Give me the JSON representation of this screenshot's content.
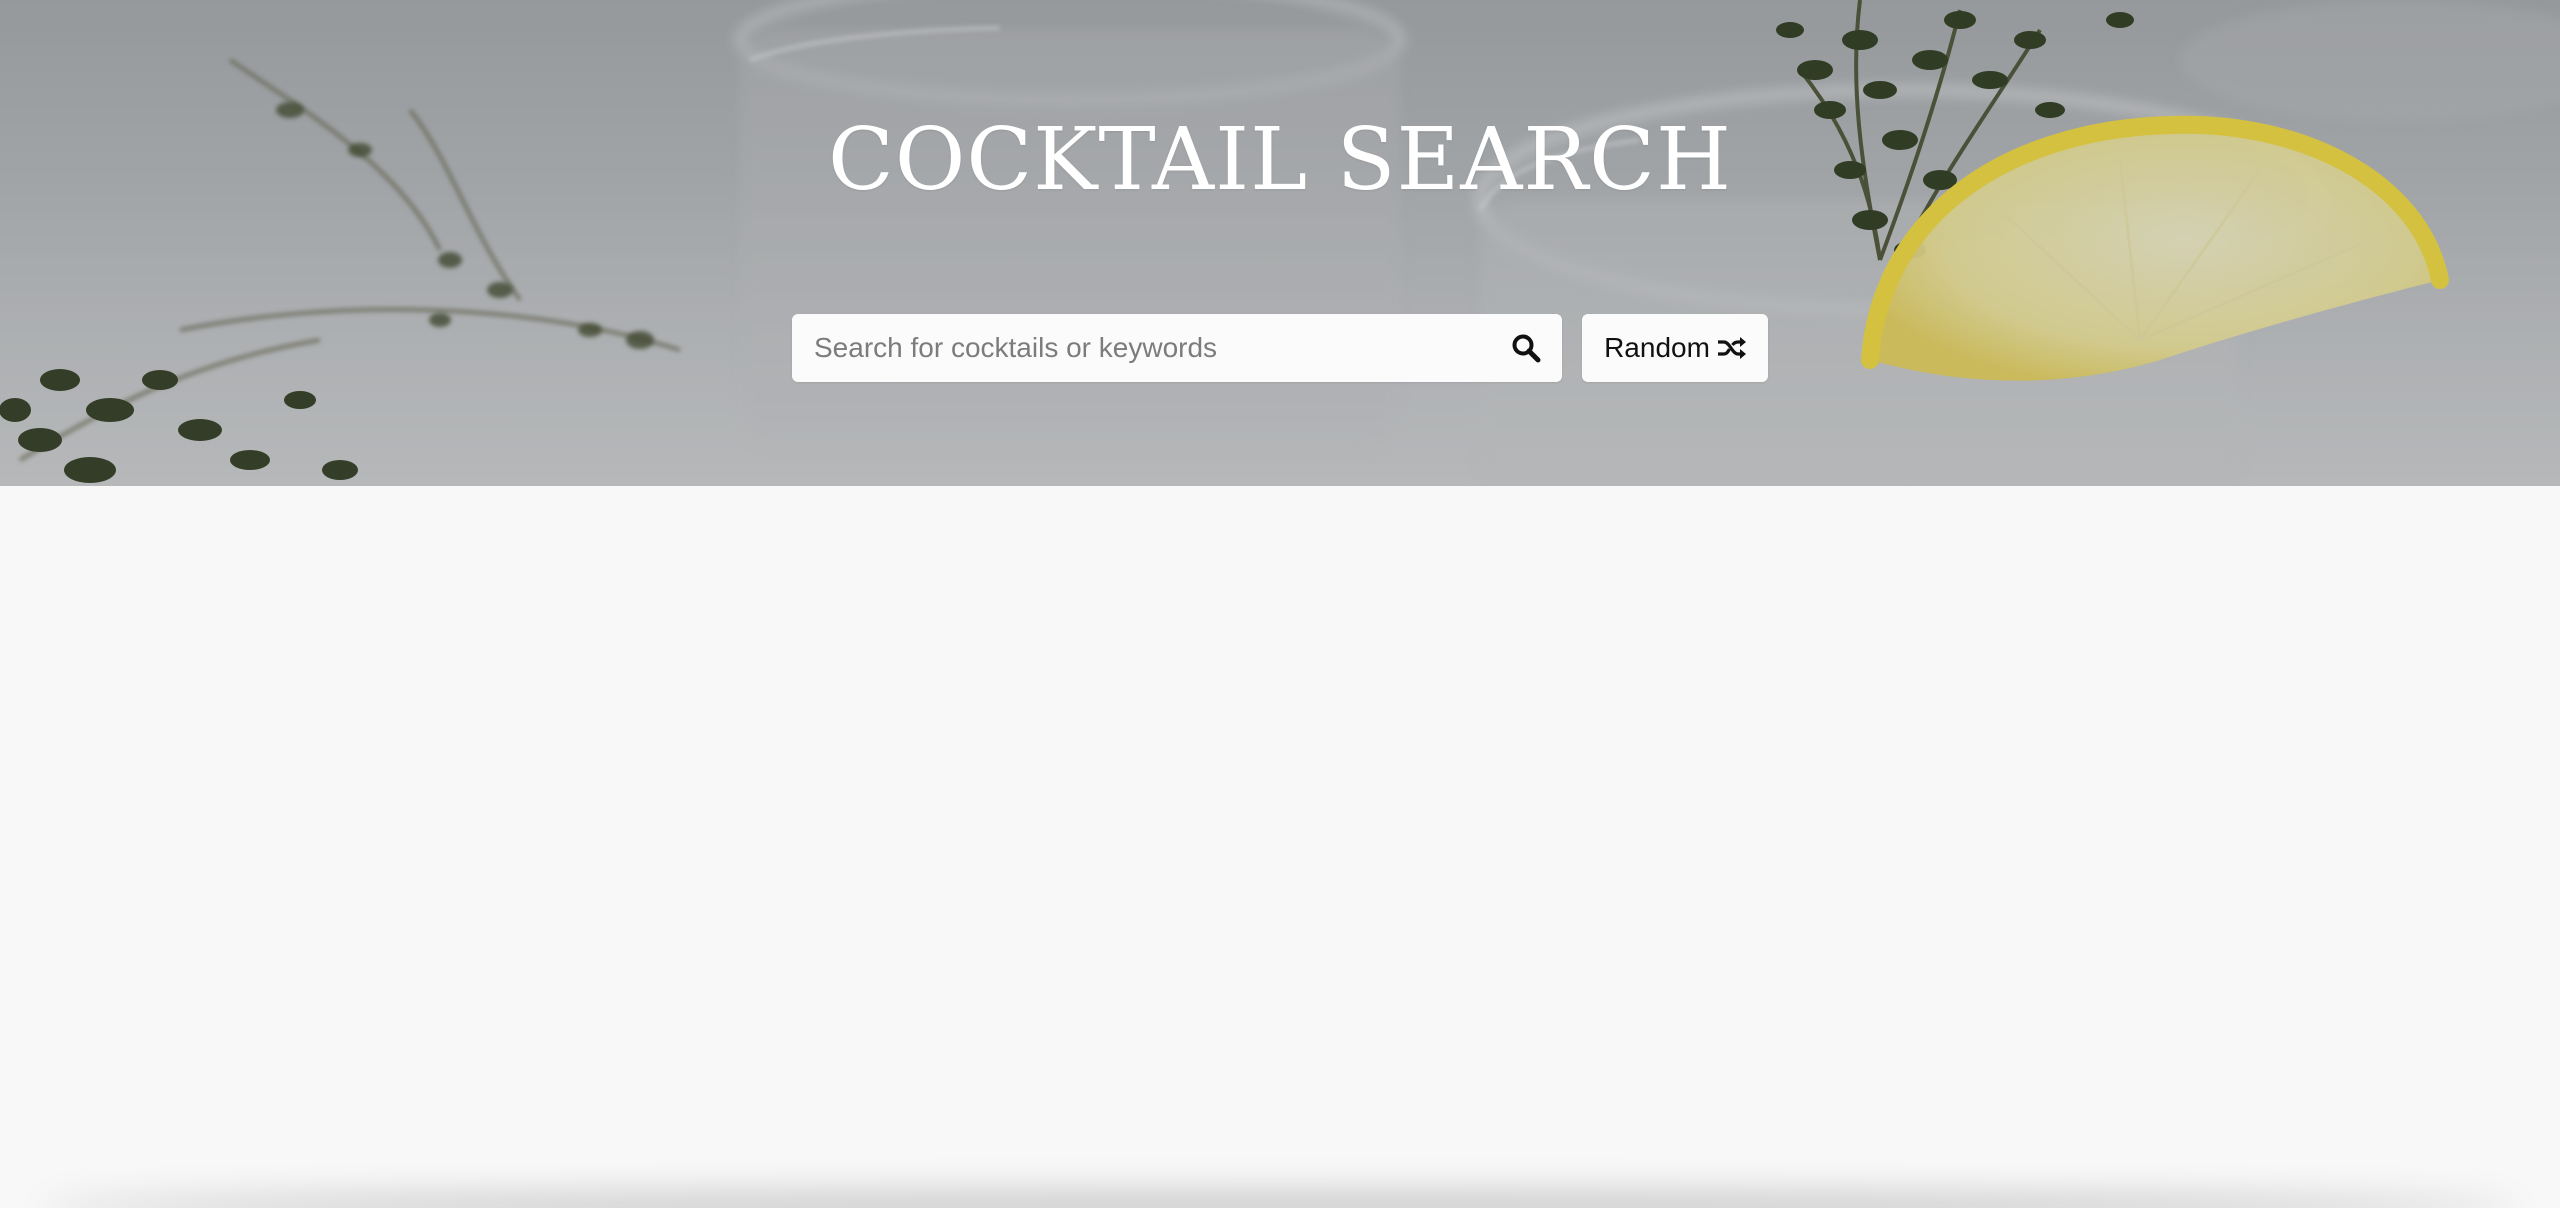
{
  "header": {
    "title": "COCKTAIL SEARCH"
  },
  "search": {
    "placeholder": "Search for cocktails or keywords",
    "value": "",
    "button_icon": "search-icon"
  },
  "random": {
    "label": "Random",
    "icon": "shuffle-icon"
  },
  "colors": {
    "page_background": "#f8f8f8",
    "title_text": "#ffffff",
    "button_background": "#fbfbfb",
    "lemon": "#f2dc3c"
  }
}
